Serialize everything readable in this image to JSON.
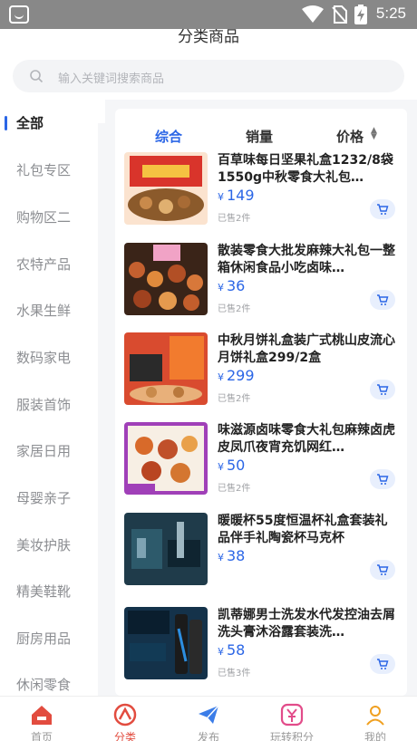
{
  "status_bar": {
    "time": "5:25"
  },
  "page_title": "分类商品",
  "search": {
    "placeholder": "输入关键词搜索商品"
  },
  "sidebar": {
    "items": [
      {
        "label": "全部",
        "active": true
      },
      {
        "label": "礼包专区"
      },
      {
        "label": "购物区二"
      },
      {
        "label": "农特产品"
      },
      {
        "label": "水果生鲜"
      },
      {
        "label": "数码家电"
      },
      {
        "label": "服装首饰"
      },
      {
        "label": "家居日用"
      },
      {
        "label": "母婴亲子"
      },
      {
        "label": "美妆护肤"
      },
      {
        "label": "精美鞋靴"
      },
      {
        "label": "厨房用品"
      },
      {
        "label": "休闲零食"
      }
    ]
  },
  "sort_tabs": {
    "comprehensive": "综合",
    "sales": "销量",
    "price": "价格"
  },
  "products": [
    {
      "name": "百草味每日坚果礼盒1232/8袋1550g中秋零食大礼包…",
      "currency": "¥",
      "price": "149",
      "sold": "已售2件"
    },
    {
      "name": "散装零食大批发麻辣大礼包一整箱休闲食品小吃卤味…",
      "currency": "¥",
      "price": "36",
      "sold": "已售2件"
    },
    {
      "name": "中秋月饼礼盒装广式桃山皮流心月饼礼盒299/2盒",
      "currency": "¥",
      "price": "299",
      "sold": "已售2件"
    },
    {
      "name": "味滋源卤味零食大礼包麻辣卤虎皮凤爪夜宵充饥网红…",
      "currency": "¥",
      "price": "50",
      "sold": "已售2件"
    },
    {
      "name": "暖暖杯55度恒温杯礼盒套装礼品伴手礼陶瓷杯马克杯",
      "currency": "¥",
      "price": "38",
      "sold": ""
    },
    {
      "name": "凯蒂娜男士洗发水代发控油去屑洗头膏沐浴露套装洗…",
      "currency": "¥",
      "price": "58",
      "sold": "已售3件"
    }
  ],
  "tabbar": {
    "items": [
      {
        "label": "首页",
        "icon": "home-icon"
      },
      {
        "label": "分类",
        "icon": "category-icon",
        "active": true
      },
      {
        "label": "发布",
        "icon": "send-icon"
      },
      {
        "label": "玩转积分",
        "icon": "points-icon"
      },
      {
        "label": "我的",
        "icon": "profile-icon"
      }
    ]
  },
  "colors": {
    "accent": "#2b66e6",
    "tab_active": "#e24c3f"
  }
}
